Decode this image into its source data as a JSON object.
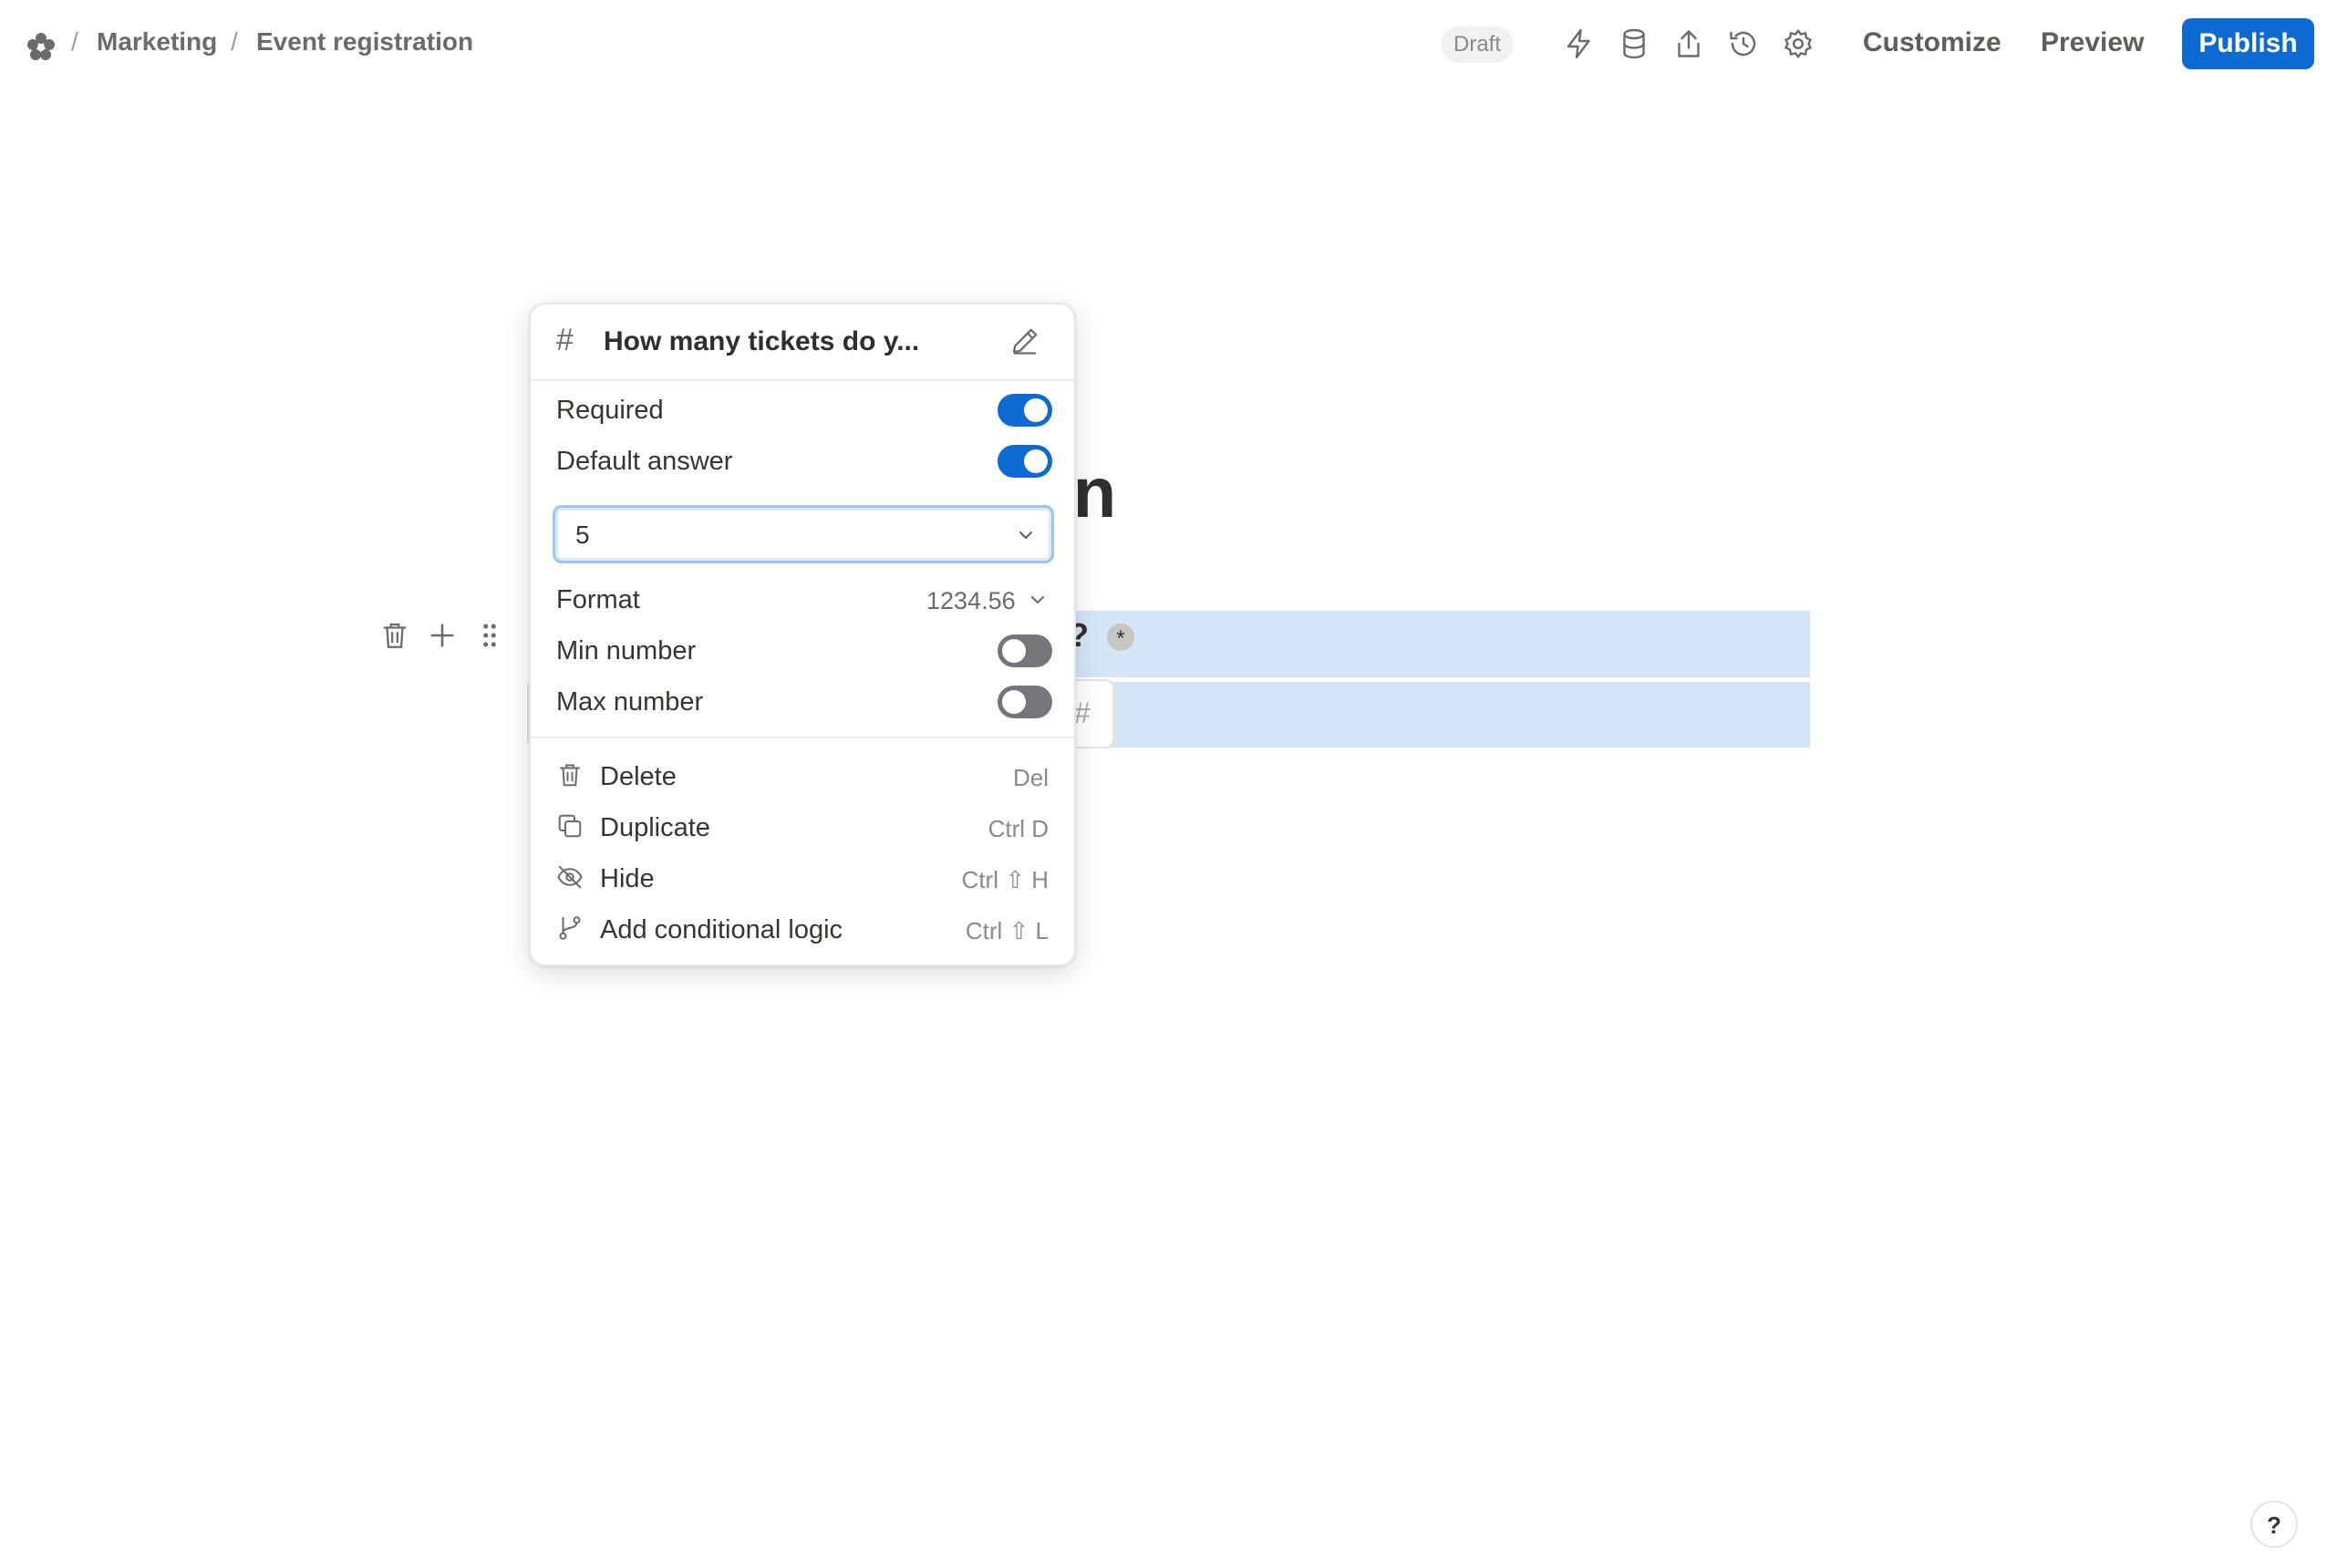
{
  "header": {
    "breadcrumb": [
      "Marketing",
      "Event registration"
    ],
    "separator": "/",
    "status_badge": "Draft",
    "customize_label": "Customize",
    "preview_label": "Preview",
    "publish_label": "Publish",
    "icons": [
      "logo-icon",
      "lightning-icon",
      "database-icon",
      "share-icon",
      "history-icon",
      "settings-icon"
    ]
  },
  "form": {
    "title_fragment": "on",
    "question_fragment": "?",
    "required_marker": "*",
    "answer_placeholder": "#"
  },
  "popover": {
    "field_type_icon": "#",
    "question_title": "How many tickets do y...",
    "options": {
      "required_label": "Required",
      "required_on": true,
      "default_answer_label": "Default answer",
      "default_answer_on": true,
      "default_value": "5",
      "format_label": "Format",
      "format_value": "1234.56",
      "min_label": "Min number",
      "min_on": false,
      "max_label": "Max number",
      "max_on": false
    },
    "actions": [
      {
        "label": "Delete",
        "shortcut": "Del",
        "icon": "trash-icon"
      },
      {
        "label": "Duplicate",
        "shortcut": "Ctrl D",
        "icon": "duplicate-icon"
      },
      {
        "label": "Hide",
        "shortcut": "Ctrl ⇧ H",
        "icon": "eye-off-icon"
      },
      {
        "label": "Add conditional logic",
        "shortcut": "Ctrl ⇧ L",
        "icon": "branch-icon"
      }
    ]
  },
  "help_label": "?",
  "colors": {
    "accent": "#0b6bd3",
    "selection": "#d3e5f7",
    "toggle_off": "#76767a"
  }
}
